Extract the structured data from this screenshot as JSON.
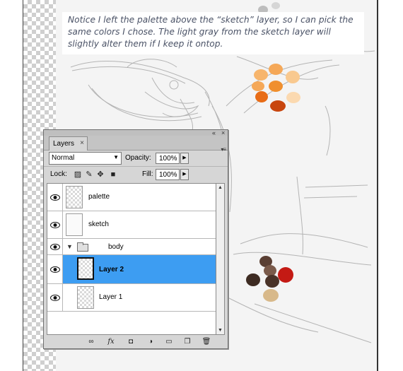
{
  "caption": {
    "text": "Notice I left the palette above the “sketch” layer, so I can pick the same colors I chose. The light gray from the sketch layer will slightly alter them if I keep it ontop."
  },
  "colors": {
    "selection": "#3d9df2",
    "panel_bg": "#d6d6d6",
    "caption_text": "#4a5266",
    "palette_orange": [
      "#f5a858",
      "#f7b56c",
      "#f9c98f",
      "#fbd9b0",
      "#f08f2e",
      "#e86c16",
      "#c8460f"
    ],
    "palette_brown": [
      "#5a3f33",
      "#6b4b3b",
      "#7a5a4a",
      "#3d2b22",
      "#c41a14",
      "#d8b98a"
    ]
  },
  "layers_panel": {
    "tab_label": "Layers",
    "close_glyph": "×",
    "collapse_glyph": "«",
    "panel_close_glyph": "×",
    "menu_glyph": "▾≡",
    "blend_mode": "Normal",
    "opacity_label": "Opacity:",
    "opacity_value": "100%",
    "lock_label": "Lock:",
    "fill_label": "Fill:",
    "fill_value": "100%",
    "lock_icons": [
      "lock-transparent-icon",
      "lock-paint-icon",
      "lock-move-icon",
      "lock-all-icon"
    ],
    "layers": [
      {
        "name": "palette",
        "visible": true,
        "selected": false,
        "type": "layer"
      },
      {
        "name": "sketch",
        "visible": true,
        "selected": false,
        "type": "layer"
      },
      {
        "name": "body",
        "visible": true,
        "selected": false,
        "type": "group",
        "expanded": true
      },
      {
        "name": "Layer 2",
        "visible": true,
        "selected": true,
        "type": "layer"
      },
      {
        "name": "Layer 1",
        "visible": true,
        "selected": false,
        "type": "layer"
      }
    ],
    "footer_icons": [
      "link-icon",
      "fx-icon",
      "mask-icon",
      "adjustment-icon",
      "group-icon",
      "new-layer-icon",
      "trash-icon"
    ],
    "footer_glyphs": {
      "link": "∞",
      "fx": "fx",
      "mask": "◘",
      "adjustment": "◑",
      "group": "▭",
      "new_layer": "❐",
      "trash": "🗑"
    }
  }
}
